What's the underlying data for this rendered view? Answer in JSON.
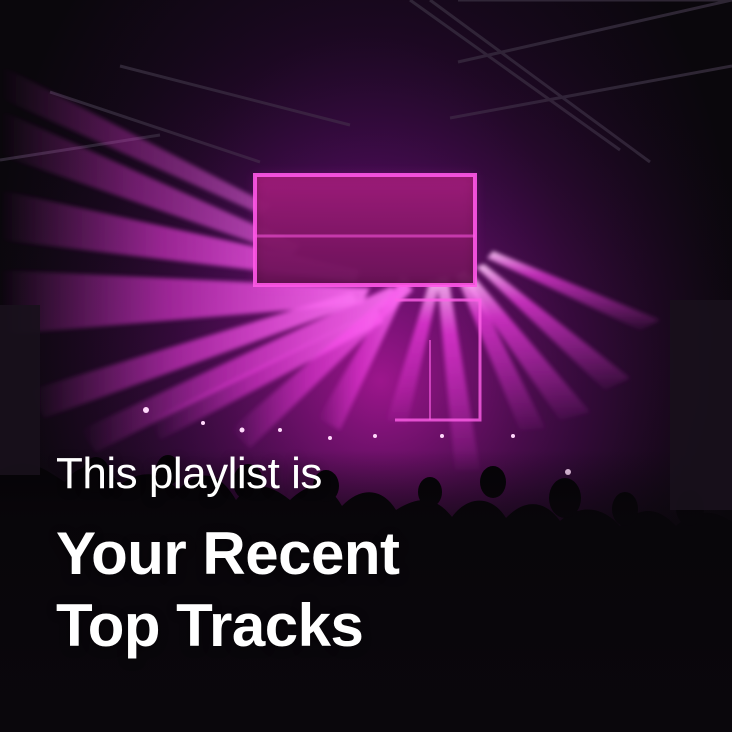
{
  "cover": {
    "subtitle": "This playlist is",
    "title_line_1": "Your Recent",
    "title_line_2": "Top Tracks"
  },
  "colors": {
    "text": "#ffffff",
    "light_beam": "#ff2fe6",
    "stage_glow": "#b0198f",
    "background": "#0a070c"
  }
}
